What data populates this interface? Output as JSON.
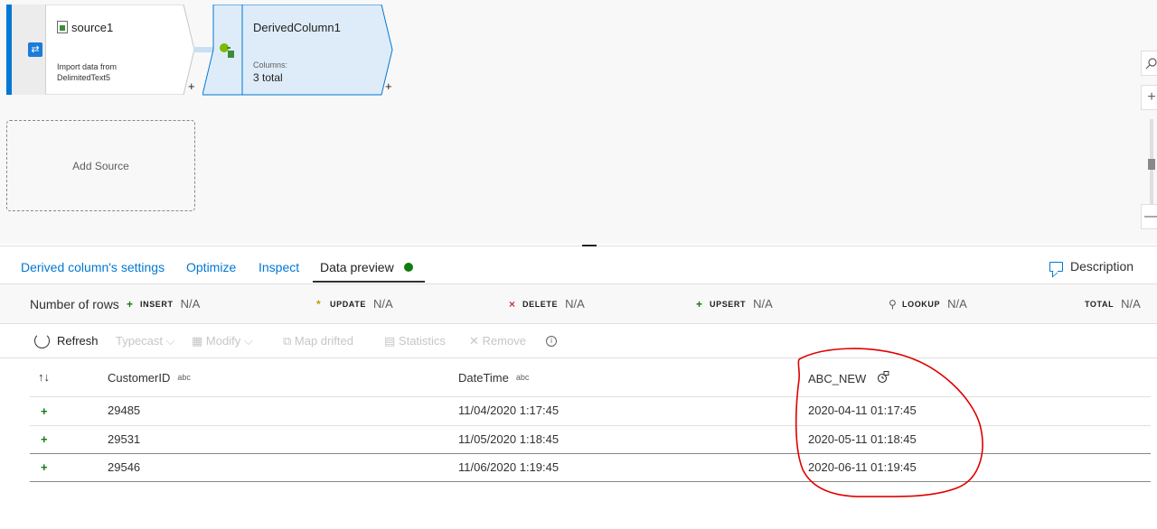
{
  "canvas": {
    "source_node": {
      "title": "source1",
      "subtitle": "Import data from DelimitedText5"
    },
    "derived_node": {
      "title": "DerivedColumn1",
      "columns_label": "Columns:",
      "columns_value": "3 total"
    },
    "plus_symbol": "+",
    "add_source_label": "Add Source",
    "zoom": {
      "search_icon": "search-icon",
      "zoom_in": "+",
      "zoom_out": "—"
    }
  },
  "tabs": [
    {
      "label": "Derived column's settings"
    },
    {
      "label": "Optimize"
    },
    {
      "label": "Inspect"
    },
    {
      "label": "Data preview"
    }
  ],
  "description_button": "Description",
  "row_stats": {
    "label": "Number of rows",
    "items": [
      {
        "symbol": "+",
        "key": "INSERT",
        "value": "N/A",
        "color": "#107c10"
      },
      {
        "symbol": "*",
        "key": "UPDATE",
        "value": "N/A",
        "color": "#c19c00"
      },
      {
        "symbol": "×",
        "key": "DELETE",
        "value": "N/A",
        "color": "#d13438"
      },
      {
        "symbol": "+",
        "key": "UPSERT",
        "value": "N/A",
        "color": "#107c10"
      },
      {
        "symbol": "⚲",
        "key": "LOOKUP",
        "value": "N/A",
        "color": "#605e5c"
      },
      {
        "symbol": "",
        "key": "TOTAL",
        "value": "N/A",
        "color": "#201f1e"
      }
    ]
  },
  "toolbar": {
    "refresh": "Refresh",
    "typecast": "Typecast",
    "modify": "Modify",
    "map_drifted": "Map drifted",
    "statistics": "Statistics",
    "remove": "Remove"
  },
  "grid": {
    "columns": [
      {
        "name": "CustomerID",
        "type": "abc"
      },
      {
        "name": "DateTime",
        "type": "abc"
      },
      {
        "name": "ABC_NEW",
        "type": ""
      }
    ],
    "rows": [
      [
        "29485",
        "11/04/2020 1:17:45",
        "2020-04-11 01:17:45"
      ],
      [
        "29531",
        "11/05/2020 1:18:45",
        "2020-05-11 01:18:45"
      ],
      [
        "29546",
        "11/06/2020 1:19:45",
        "2020-06-11 01:19:45"
      ]
    ],
    "row_marker": "+"
  },
  "colors": {
    "accent": "#0078d4",
    "success": "#107c10",
    "annotation": "#e00000"
  }
}
